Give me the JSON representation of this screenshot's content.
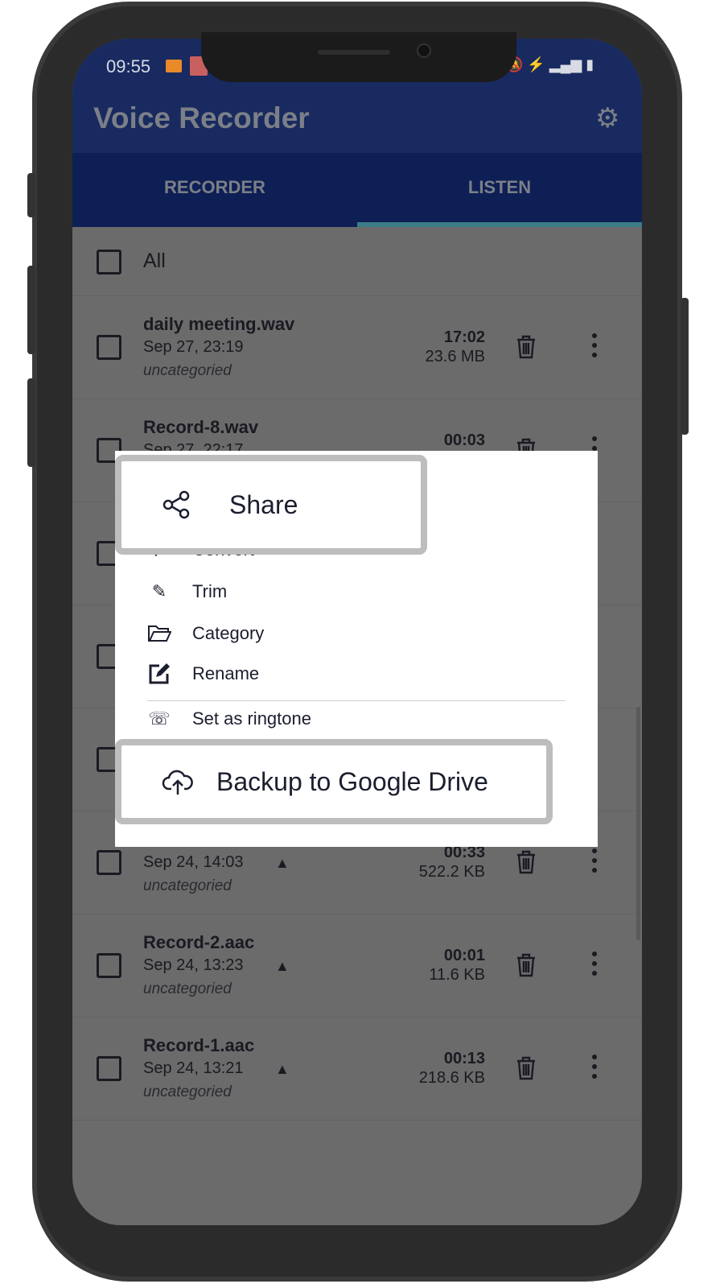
{
  "status": {
    "time": "09:55"
  },
  "app": {
    "title": "Voice Recorder",
    "settings_icon": "gear-icon"
  },
  "tabs": [
    {
      "label": "RECORDER",
      "active": false
    },
    {
      "label": "LISTEN",
      "active": true
    }
  ],
  "list": {
    "select_all_label": "All",
    "items": [
      {
        "name": "daily meeting.wav",
        "date": "Sep 27, 23:19",
        "category": "uncategoried",
        "duration": "17:02",
        "size": "23.6 MB",
        "drive": false
      },
      {
        "name": "Record-8.wav",
        "date": "Sep 27, 22:17",
        "category": "",
        "duration": "00:03",
        "size": "",
        "drive": false
      },
      {
        "name": "",
        "date": "",
        "category": "",
        "duration": "",
        "size": ""
      },
      {
        "name": "",
        "date": "",
        "category": "",
        "duration": "",
        "size": ""
      },
      {
        "name": "",
        "date": "",
        "category": "",
        "duration": "",
        "size": ""
      },
      {
        "name": "",
        "date": "Sep 24, 14:03",
        "category": "uncategoried",
        "duration": "00:33",
        "size": "522.2 KB",
        "drive": true
      },
      {
        "name": "Record-2.aac",
        "date": "Sep 24, 13:23",
        "category": "uncategoried",
        "duration": "00:01",
        "size": "11.6 KB",
        "drive": true
      },
      {
        "name": "Record-1.aac",
        "date": "Sep 24, 13:21",
        "category": "uncategoried",
        "duration": "00:13",
        "size": "218.6 KB",
        "drive": true
      }
    ]
  },
  "menu": {
    "share": "Share",
    "convert": "Convert",
    "trim": "Trim",
    "category": "Category",
    "rename": "Rename",
    "ringtone": "Set as ringtone",
    "backup": "Backup to Google Drive"
  },
  "colors": {
    "header": "#182a5f",
    "tabbar": "#0e1f55",
    "indicator": "#3b7c86",
    "highlight_border": "#bdbdbd"
  }
}
